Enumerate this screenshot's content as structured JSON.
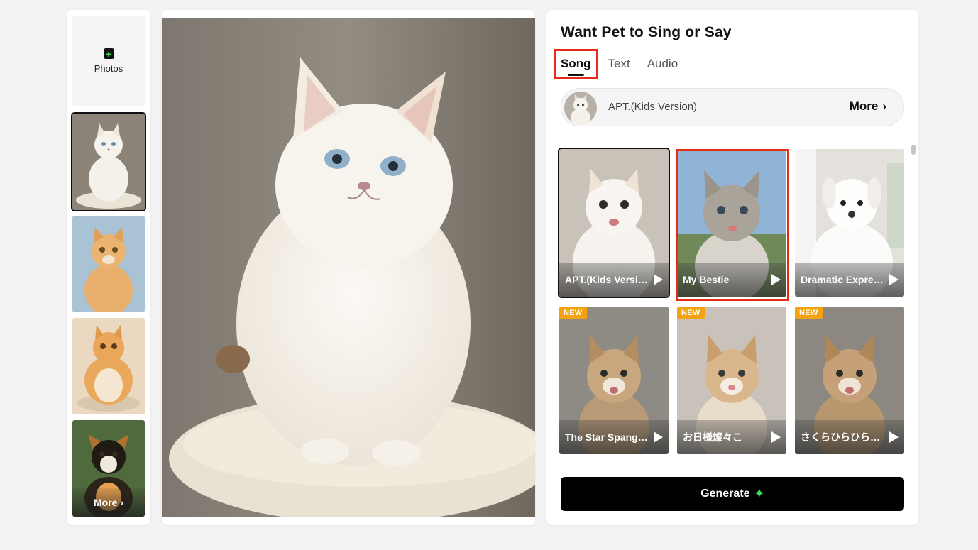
{
  "left_column": {
    "upload_label": "Photos",
    "more_label": "More",
    "thumbnails": [
      {
        "name": "white-fluffy-cat",
        "selected": true
      },
      {
        "name": "orange-tabby-cat",
        "selected": false
      },
      {
        "name": "chubby-orange-cat",
        "selected": false
      },
      {
        "name": "tricolor-puppy",
        "selected": false
      }
    ]
  },
  "main_image": {
    "subject": "white fluffy cat on cushion"
  },
  "panel": {
    "title": "Want Pet to Sing or Say",
    "tabs": [
      {
        "label": "Song",
        "active": true
      },
      {
        "label": "Text",
        "active": false
      },
      {
        "label": "Audio",
        "active": false
      }
    ],
    "selected_song": {
      "name": "APT.(Kids Version)",
      "more_label": "More"
    },
    "songs": [
      {
        "title": "APT.(Kids Version)",
        "new": false,
        "selected": true
      },
      {
        "title": "My Bestie",
        "new": false,
        "selected": false
      },
      {
        "title": "Dramatic Expression",
        "new": false,
        "selected": false
      },
      {
        "title": "The Star Spangled Banner",
        "new": true,
        "selected": false
      },
      {
        "title": "お日様燦々こ",
        "new": true,
        "selected": false
      },
      {
        "title": "さくらひらひら舞い",
        "new": true,
        "selected": false
      }
    ],
    "new_badge": "NEW",
    "generate_label": "Generate"
  },
  "colors": {
    "accent_green": "#3ddc52",
    "highlight_red": "#e52d16",
    "new_badge": "#f2a30f"
  }
}
